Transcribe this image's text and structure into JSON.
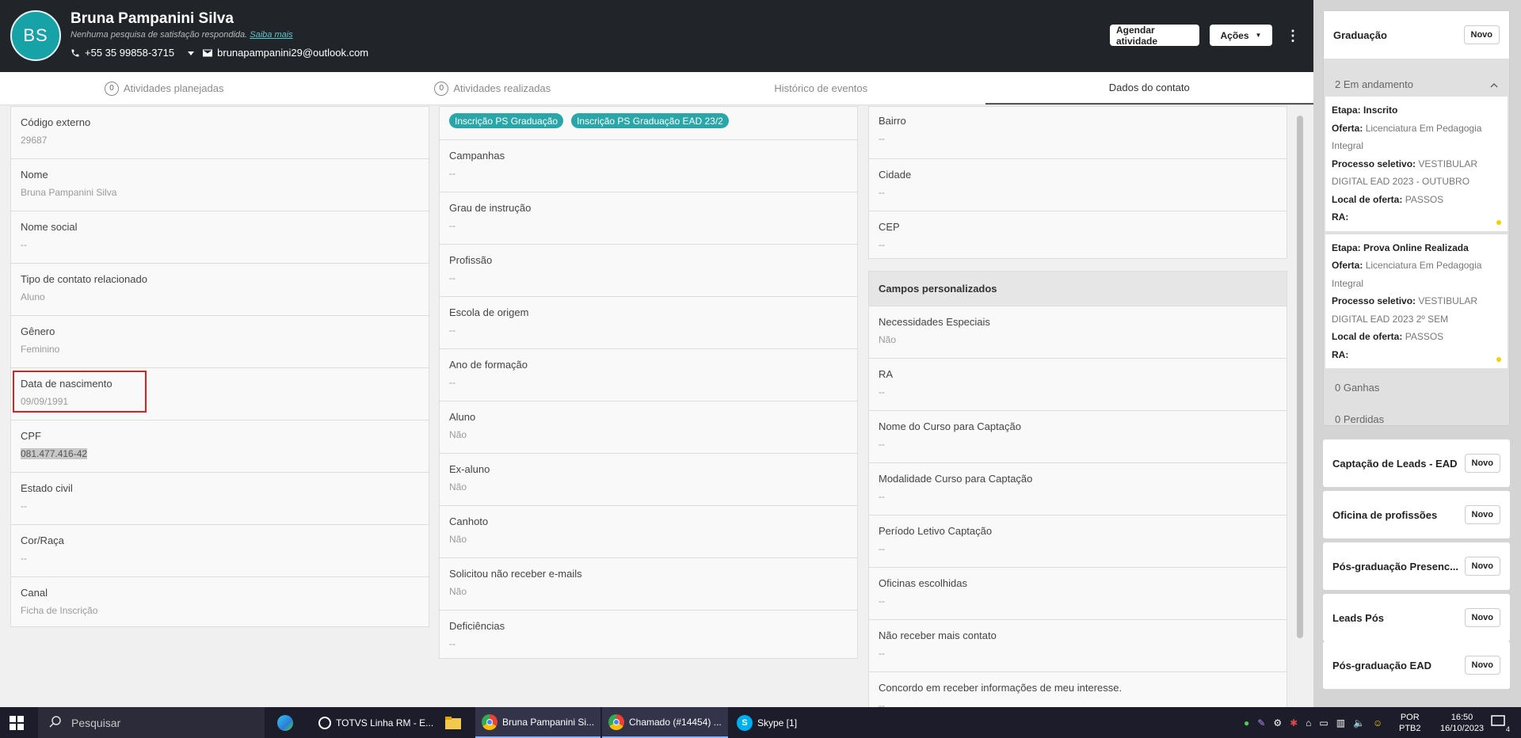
{
  "header": {
    "initials": "BS",
    "name": "Bruna Pampanini Silva",
    "survey_text": "Nenhuma pesquisa de satisfação respondida.",
    "survey_link": "Saiba mais",
    "phone": "+55 35 99858-3715",
    "email": "brunapampanini29@outlook.com",
    "btn_agendar": "Agendar atividade",
    "btn_acoes": "Ações"
  },
  "tabs": [
    {
      "count": "0",
      "label": "Atividades planejadas"
    },
    {
      "count": "0",
      "label": "Atividades realizadas"
    },
    {
      "label": "Histórico de eventos"
    },
    {
      "label": "Dados do contato"
    }
  ],
  "col1": [
    {
      "label": "Código externo",
      "value": "29687"
    },
    {
      "label": "Nome",
      "value": "Bruna Pampanini Silva"
    },
    {
      "label": "Nome social",
      "value": "--"
    },
    {
      "label": "Tipo de contato relacionado",
      "value": "Aluno"
    },
    {
      "label": "Gênero",
      "value": "Feminino"
    },
    {
      "label": "Data de nascimento",
      "value": "09/09/1991"
    },
    {
      "label": "CPF",
      "value": "081.477.416-42"
    },
    {
      "label": "Estado civil",
      "value": "--"
    },
    {
      "label": "Cor/Raça",
      "value": "--"
    },
    {
      "label": "Canal",
      "value": "Ficha de Inscrição"
    }
  ],
  "col2": {
    "tags": [
      "Inscrição PS Graduação",
      "Inscrição PS Graduação EAD 23/2"
    ],
    "fields": [
      {
        "label": "Campanhas",
        "value": "--"
      },
      {
        "label": "Grau de instrução",
        "value": "--"
      },
      {
        "label": "Profissão",
        "value": "--"
      },
      {
        "label": "Escola de origem",
        "value": "--"
      },
      {
        "label": "Ano de formação",
        "value": "--"
      },
      {
        "label": "Aluno",
        "value": "Não"
      },
      {
        "label": "Ex-aluno",
        "value": "Não"
      },
      {
        "label": "Canhoto",
        "value": "Não"
      },
      {
        "label": "Solicitou não receber e-mails",
        "value": "Não"
      },
      {
        "label": "Deficiências",
        "value": "--"
      }
    ]
  },
  "col3": [
    {
      "label": "Bairro",
      "value": "--"
    },
    {
      "label": "Cidade",
      "value": "--"
    },
    {
      "label": "CEP",
      "value": "--"
    }
  ],
  "col4": {
    "title": "Campos personalizados",
    "fields": [
      {
        "label": "Necessidades Especiais",
        "value": "Não"
      },
      {
        "label": "RA",
        "value": "--"
      },
      {
        "label": "Nome do Curso para Captação",
        "value": "--"
      },
      {
        "label": "Modalidade Curso para Captação",
        "value": "--"
      },
      {
        "label": "Período Letivo Captação",
        "value": "--"
      },
      {
        "label": "Oficinas escolhidas",
        "value": "--"
      },
      {
        "label": "Não receber mais contato",
        "value": "--"
      },
      {
        "label": "Concordo em receber informações de meu interesse.",
        "value": "--"
      }
    ]
  },
  "sidebar": {
    "graduacao": {
      "name": "Graduação",
      "novo": "Novo",
      "em_andamento": "2 Em andamento",
      "opps": [
        {
          "etapa_lbl": "Etapa:",
          "etapa": "Inscrito",
          "oferta_lbl": "Oferta:",
          "oferta": "Licenciatura Em Pedagogia Integral",
          "proc_lbl": "Processo seletivo:",
          "proc": "VESTIBULAR DIGITAL EAD 2023 - OUTUBRO",
          "local_lbl": "Local de oferta:",
          "local": "PASSOS",
          "ra_lbl": "RA:"
        },
        {
          "etapa_lbl": "Etapa:",
          "etapa": "Prova Online Realizada",
          "oferta_lbl": "Oferta:",
          "oferta": "Licenciatura Em Pedagogia Integral",
          "proc_lbl": "Processo seletivo:",
          "proc": "VESTIBULAR DIGITAL EAD 2023 2º SEM",
          "local_lbl": "Local de oferta:",
          "local": "PASSOS",
          "ra_lbl": "RA:"
        }
      ],
      "ganhas": "0 Ganhas",
      "perdidas": "0 Perdidas"
    },
    "funnels": [
      {
        "name": "Captação de Leads - EAD",
        "novo": "Novo"
      },
      {
        "name": "Oficina de profissões",
        "novo": "Novo"
      },
      {
        "name": "Pós-graduação Presenc...",
        "novo": "Novo"
      },
      {
        "name": "Leads Pós",
        "novo": "Novo"
      },
      {
        "name": "Pós-graduação EAD",
        "novo": "Novo"
      }
    ]
  },
  "taskbar": {
    "search": "Pesquisar",
    "apps": [
      "TOTVS Linha RM - E...",
      "Bruna Pampanini Si...",
      "Chamado (#14454) ...",
      "Skype [1]"
    ],
    "lang": "POR",
    "layout": "PTB2",
    "time": "16:50",
    "date": "16/10/2023",
    "notif": "4"
  },
  "colors": {
    "header_bg": "#212529",
    "accent": "#2aa6a8",
    "highlight": "#e02020"
  }
}
